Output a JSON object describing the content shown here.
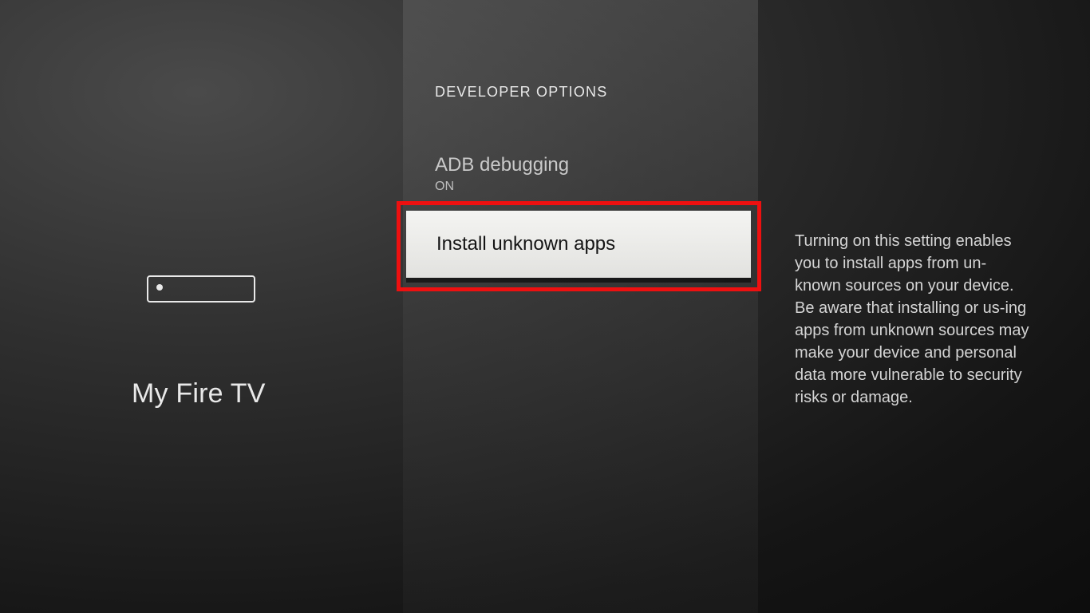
{
  "left": {
    "title": "My Fire TV"
  },
  "mid": {
    "header": "DEVELOPER OPTIONS",
    "options": {
      "adb": {
        "label": "ADB debugging",
        "value": "ON"
      },
      "install_unknown": {
        "label": "Install unknown apps"
      }
    }
  },
  "right": {
    "description": "Turning on this setting enables you to install apps from un‐known sources on your device. Be aware that installing or us‐ing apps from unknown sources may make your device and personal data more vulnerable to security risks or damage."
  }
}
